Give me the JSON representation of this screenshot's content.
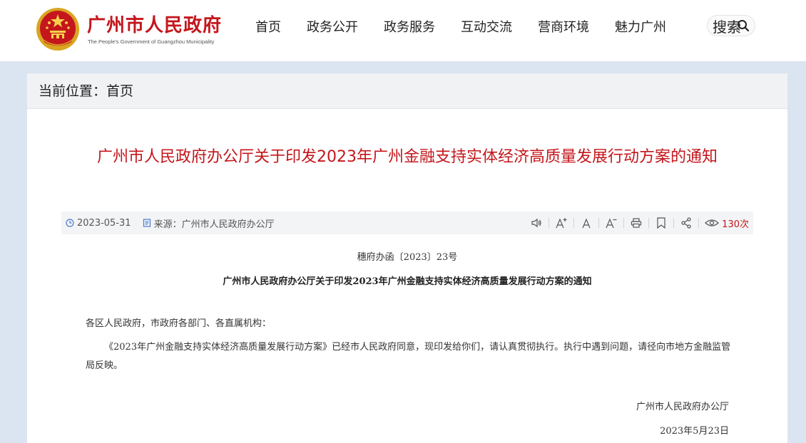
{
  "header": {
    "logo_cn": "广州市人民政府",
    "logo_en": "The People's Government of Guangzhou Municipality",
    "nav": [
      "首页",
      "政务公开",
      "政务服务",
      "互动交流",
      "营商环境",
      "魅力广州"
    ],
    "search_label": "搜索"
  },
  "breadcrumb": {
    "text": "当前位置：首页"
  },
  "article": {
    "title": "广州市人民政府办公厅关于印发2023年广州金融支持实体经济高质量发展行动方案的通知",
    "date": "2023-05-31",
    "source": "来源：广州市人民政府办公厅",
    "views": "130次",
    "doc_number": "穗府办函〔2023〕23号",
    "doc_title": "广州市人民政府办公厅关于印发2023年广州金融支持实体经济高质量发展行动方案的通知",
    "salutation": "各区人民政府，市政府各部门、各直属机构：",
    "body": "《2023年广州金融支持实体经济高质量发展行动方案》已经市人民政府同意，现印发给你们，请认真贯彻执行。执行中遇到问题，请径向市地方金融监管局反映。",
    "signature_office": "广州市人民政府办公厅",
    "signature_date": "2023年5月23日"
  },
  "colors": {
    "accent": "#c4161c",
    "band": "#dbe5f1"
  }
}
